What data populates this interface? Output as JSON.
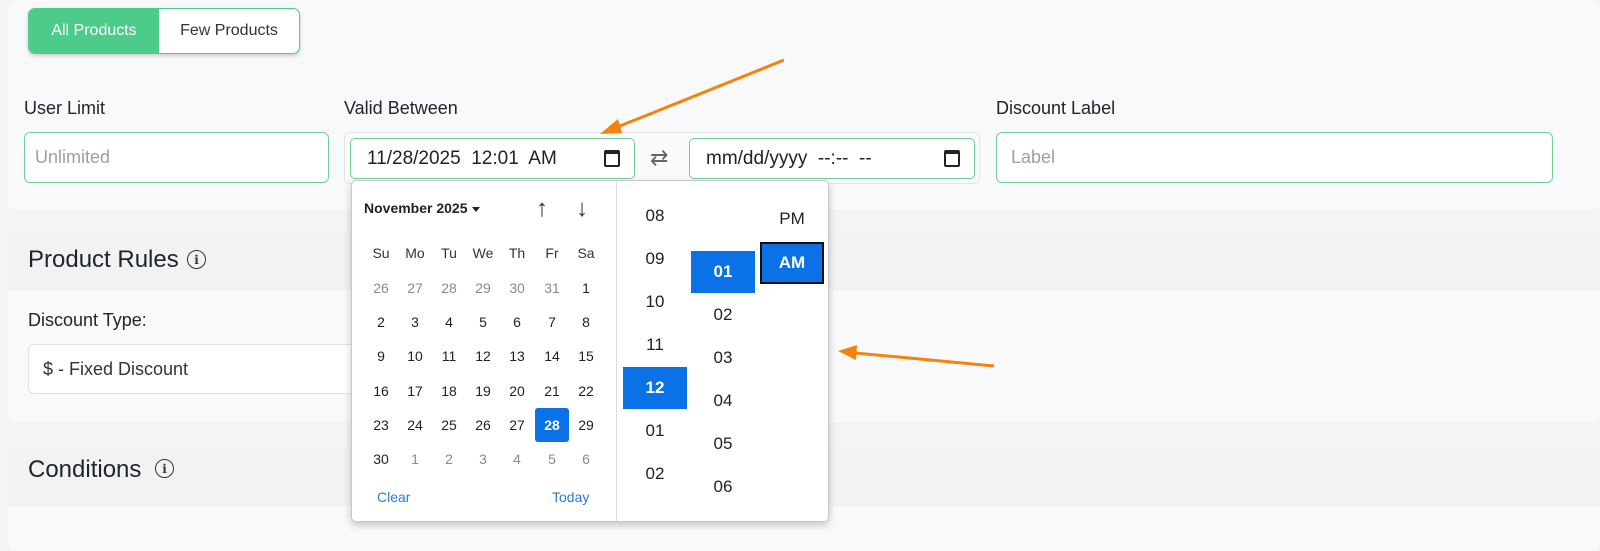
{
  "segment": {
    "all_label": "All Products",
    "few_label": "Few Products"
  },
  "user_limit": {
    "label": "User Limit",
    "placeholder": "Unlimited"
  },
  "valid_between": {
    "label": "Valid Between",
    "start_value": "11/28/2025  12:01  AM",
    "end_placeholder": "mm/dd/yyyy  --:--  --"
  },
  "discount_label": {
    "label": "Discount Label",
    "placeholder": "Label"
  },
  "product_rules": {
    "title": "Product Rules",
    "discount_type_label": "Discount Type:",
    "discount_type_value": "$ - Fixed Discount"
  },
  "conditions": {
    "title": "Conditions"
  },
  "picker": {
    "month_label": "November 2025",
    "weekdays": [
      "Su",
      "Mo",
      "Tu",
      "We",
      "Th",
      "Fr",
      "Sa"
    ],
    "weeks": [
      [
        "26",
        "27",
        "28",
        "29",
        "30",
        "31",
        "1"
      ],
      [
        "2",
        "3",
        "4",
        "5",
        "6",
        "7",
        "8"
      ],
      [
        "9",
        "10",
        "11",
        "12",
        "13",
        "14",
        "15"
      ],
      [
        "16",
        "17",
        "18",
        "19",
        "20",
        "21",
        "22"
      ],
      [
        "23",
        "24",
        "25",
        "26",
        "27",
        "28",
        "29"
      ],
      [
        "30",
        "1",
        "2",
        "3",
        "4",
        "5",
        "6"
      ]
    ],
    "clear_label": "Clear",
    "today_label": "Today",
    "hours": [
      "08",
      "09",
      "10",
      "11",
      "12",
      "01",
      "02"
    ],
    "minutes": [
      "01",
      "02",
      "03",
      "04",
      "05",
      "06"
    ],
    "ampm": [
      "PM",
      "AM"
    ]
  },
  "colors": {
    "accent_green": "#4ccb8a",
    "selection_blue": "#0a72e6",
    "annotation_orange": "#f5820e"
  }
}
